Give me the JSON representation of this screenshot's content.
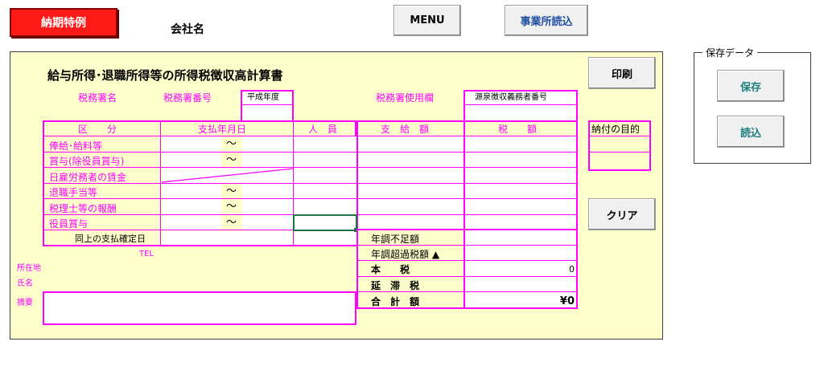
{
  "toolbar": {
    "nouki_label": "納期特例",
    "company_label": "会社名",
    "menu_label": "MENU",
    "office_read_label": "事業所読込"
  },
  "save_panel": {
    "title": "保存データ",
    "save_label": "保存",
    "load_label": "読込"
  },
  "sheet": {
    "title": "給与所得･退職所得等の所得税徴収高計算書",
    "print_label": "印刷",
    "clear_label": "クリア",
    "tax_office_name": "税務署名",
    "tax_office_number": "税務署番号",
    "era_year": "平成年度",
    "tax_office_use": "税務署使用欄",
    "withholder_number": "源泉徴収義務者番号",
    "col_category": "区　　分",
    "col_pay_date": "支払年月日",
    "col_persons": "人　員",
    "col_amount": "支　給　額",
    "col_tax": "税　　額",
    "purpose_label": "納付の目的",
    "rows": [
      {
        "label": "俸給･給料等",
        "tilde": "～"
      },
      {
        "label": "賞与(除役員賞与)",
        "tilde": "～"
      },
      {
        "label": "日雇労務者の賃金",
        "tilde": ""
      },
      {
        "label": "退職手当等",
        "tilde": "～"
      },
      {
        "label": "税理士等の報酬",
        "tilde": "～"
      },
      {
        "label": "役員賞与",
        "tilde": "～"
      }
    ],
    "confirmed_date": "同上の支払確定日",
    "tel_label": "TEL",
    "address_label": "所在地",
    "name_label": "氏名",
    "memo_label": "摘要",
    "summary": [
      {
        "label": "年調不足額",
        "value": ""
      },
      {
        "label": "年調超過税額 ▲",
        "value": ""
      },
      {
        "label": "本　　税",
        "value": "0"
      },
      {
        "label": "延　滞　税",
        "value": ""
      },
      {
        "label": "合　計　額",
        "value": "¥0"
      }
    ],
    "colors": {
      "magenta": "#ff00ff",
      "sheet_bg": "#ffffcc",
      "red_button": "#ff1a1a",
      "selected_cell_border": "#217346"
    }
  }
}
